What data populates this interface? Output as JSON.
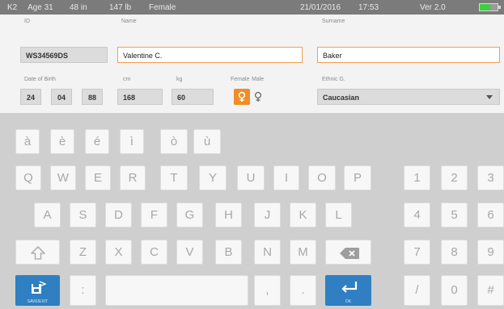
{
  "status_bar": {
    "id_code": "K2",
    "age": "Age 31",
    "height_in": "48 in",
    "weight_lb": "147 lb",
    "sex": "Female",
    "date": "21/01/2016",
    "time": "17:53",
    "version": "Ver 2.0",
    "battery_level": 0.6,
    "battery_color": "#3fcf3f"
  },
  "form": {
    "id": {
      "label": "ID",
      "value": "WS34569DS"
    },
    "name": {
      "label": "Name",
      "value": "Valentine C."
    },
    "surname": {
      "label": "Surname",
      "value": "Baker"
    },
    "dob": {
      "label": "Date of Birth",
      "day": "24",
      "month": "04",
      "year": "88"
    },
    "height": {
      "label": "cm",
      "value": "168"
    },
    "weight": {
      "label": "kg",
      "value": "60"
    },
    "gender": {
      "female_label": "Female",
      "male_label": "Male",
      "selected": "female",
      "accent": "#f08d26"
    },
    "ethnic": {
      "label": "Ethnic G.",
      "value": "Caucasian"
    }
  },
  "keyboard": {
    "accent_row": [
      "à",
      "è",
      "é",
      "ì",
      "ò",
      "ù"
    ],
    "row1": [
      "Q",
      "W",
      "E",
      "R",
      "T",
      "Y",
      "U",
      "I",
      "O",
      "P"
    ],
    "row2": [
      "A",
      "S",
      "D",
      "F",
      "G",
      "H",
      "J",
      "K",
      "L"
    ],
    "row3": [
      "Z",
      "X",
      "C",
      "V",
      "B",
      "N",
      "M"
    ],
    "punct": [
      ":",
      ",",
      "."
    ],
    "numpad": [
      "1",
      "2",
      "3",
      "4",
      "5",
      "6",
      "7",
      "8",
      "9",
      "/",
      "0",
      "#"
    ],
    "save_exit_label": "SAVE/EXIT",
    "ok_label": "OK",
    "key_color": "#f7f7f7",
    "accent_color": "#2f7fc2",
    "icons": {
      "shift": "shift-icon",
      "backspace": "backspace-icon",
      "save_exit": "save-exit-icon",
      "enter": "enter-icon"
    }
  }
}
